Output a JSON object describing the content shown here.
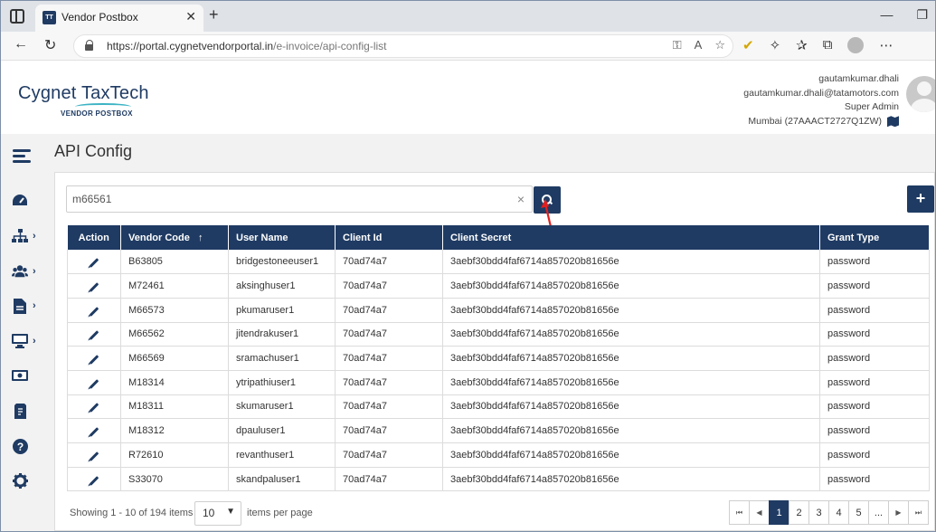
{
  "browser": {
    "tab_title": "Vendor Postbox",
    "tab_favicon": "TT",
    "url_host": "https://portal.cygnetvendorportal.in",
    "url_path": "/e-invoice/api-config-list"
  },
  "brand": {
    "name": "Cygnet TaxTech",
    "sub": "VENDOR POSTBOX"
  },
  "user": {
    "username": "gautamkumar.dhali",
    "email": "gautamkumar.dhali@tatamotors.com",
    "role": "Super Admin",
    "location": "Mumbai (27AAACT2727Q1ZW)"
  },
  "page": {
    "title": "API Config"
  },
  "search": {
    "value": "m66561",
    "clear": "×"
  },
  "table": {
    "headers": [
      "Action",
      "Vendor Code",
      "User Name",
      "Client Id",
      "Client Secret",
      "Grant Type"
    ],
    "sort_indicator": "↑",
    "rows": [
      {
        "vendor_code": "B63805",
        "user_name": "bridgestoneeuser1",
        "client_id": "70ad74a7",
        "client_secret": "3aebf30bdd4faf6714a857020b81656e",
        "grant_type": "password"
      },
      {
        "vendor_code": "M72461",
        "user_name": "aksinghuser1",
        "client_id": "70ad74a7",
        "client_secret": "3aebf30bdd4faf6714a857020b81656e",
        "grant_type": "password"
      },
      {
        "vendor_code": "M66573",
        "user_name": "pkumaruser1",
        "client_id": "70ad74a7",
        "client_secret": "3aebf30bdd4faf6714a857020b81656e",
        "grant_type": "password"
      },
      {
        "vendor_code": "M66562",
        "user_name": "jitendrakuser1",
        "client_id": "70ad74a7",
        "client_secret": "3aebf30bdd4faf6714a857020b81656e",
        "grant_type": "password"
      },
      {
        "vendor_code": "M66569",
        "user_name": "sramachuser1",
        "client_id": "70ad74a7",
        "client_secret": "3aebf30bdd4faf6714a857020b81656e",
        "grant_type": "password"
      },
      {
        "vendor_code": "M18314",
        "user_name": "ytripathiuser1",
        "client_id": "70ad74a7",
        "client_secret": "3aebf30bdd4faf6714a857020b81656e",
        "grant_type": "password"
      },
      {
        "vendor_code": "M18311",
        "user_name": "skumaruser1",
        "client_id": "70ad74a7",
        "client_secret": "3aebf30bdd4faf6714a857020b81656e",
        "grant_type": "password"
      },
      {
        "vendor_code": "M18312",
        "user_name": "dpauluser1",
        "client_id": "70ad74a7",
        "client_secret": "3aebf30bdd4faf6714a857020b81656e",
        "grant_type": "password"
      },
      {
        "vendor_code": "R72610",
        "user_name": "revanthuser1",
        "client_id": "70ad74a7",
        "client_secret": "3aebf30bdd4faf6714a857020b81656e",
        "grant_type": "password"
      },
      {
        "vendor_code": "S33070",
        "user_name": "skandpaluser1",
        "client_id": "70ad74a7",
        "client_secret": "3aebf30bdd4faf6714a857020b81656e",
        "grant_type": "password"
      }
    ]
  },
  "footer": {
    "showing": "Showing 1 - 10 of 194 items",
    "per_page_value": "10",
    "per_page_label": "items per page",
    "pages": [
      "1",
      "2",
      "3",
      "4",
      "5",
      "..."
    ],
    "active_page": "1",
    "first": "⏮",
    "prev": "◀",
    "next": "▶",
    "last": "⏭"
  },
  "colors": {
    "primary": "#1f3b63",
    "accent": "#3bb3c3",
    "annotation_arrow": "#e02020"
  },
  "icons": [
    "dashboard-icon",
    "hierarchy-icon",
    "users-icon",
    "document-icon",
    "monitor-icon",
    "money-icon",
    "receipt-icon",
    "help-icon",
    "settings-icon"
  ]
}
